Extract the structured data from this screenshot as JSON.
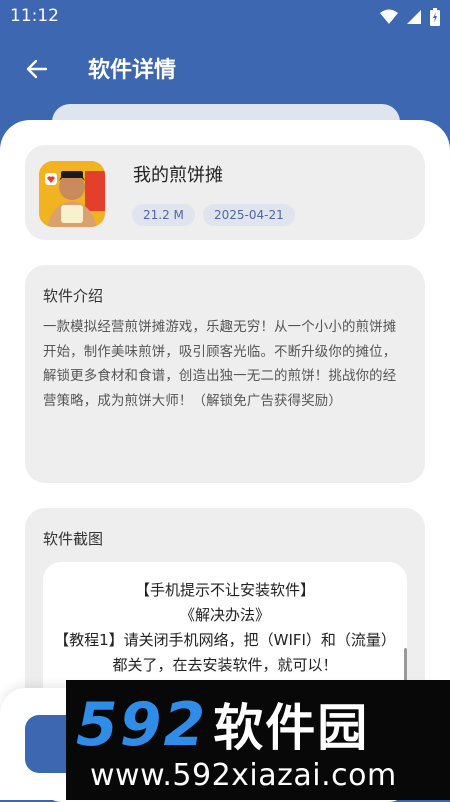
{
  "status_bar": {
    "time": "11:12"
  },
  "header": {
    "title": "软件详情"
  },
  "app": {
    "name": "我的煎饼摊",
    "size": "21.2 M",
    "date": "2025-04-21"
  },
  "intro": {
    "title": "软件介绍",
    "text": "一款模拟经营煎饼摊游戏，乐趣无穷！从一个小小的煎饼摊开始，制作美味煎饼，吸引顾客光临。不断升级你的摊位，解锁更多食材和食谱，创造出独一无二的煎饼！挑战你的经营策略，成为煎饼大师！（解锁免广告获得奖励）"
  },
  "screenshots": {
    "title": "软件截图",
    "lines": [
      "【手机提示不让安装软件】",
      "《解决办法》",
      "【教程1】请关闭手机网络，把（WIFI）和（流量）都关了，在去安装软件，就可以！"
    ]
  },
  "watermark": {
    "number": "592",
    "brand": "软件园",
    "url": "www.592xiazai.com"
  },
  "colors": {
    "primary": "#3d67b0",
    "card": "#eeeeee",
    "chip_text": "#4a6aa6"
  }
}
